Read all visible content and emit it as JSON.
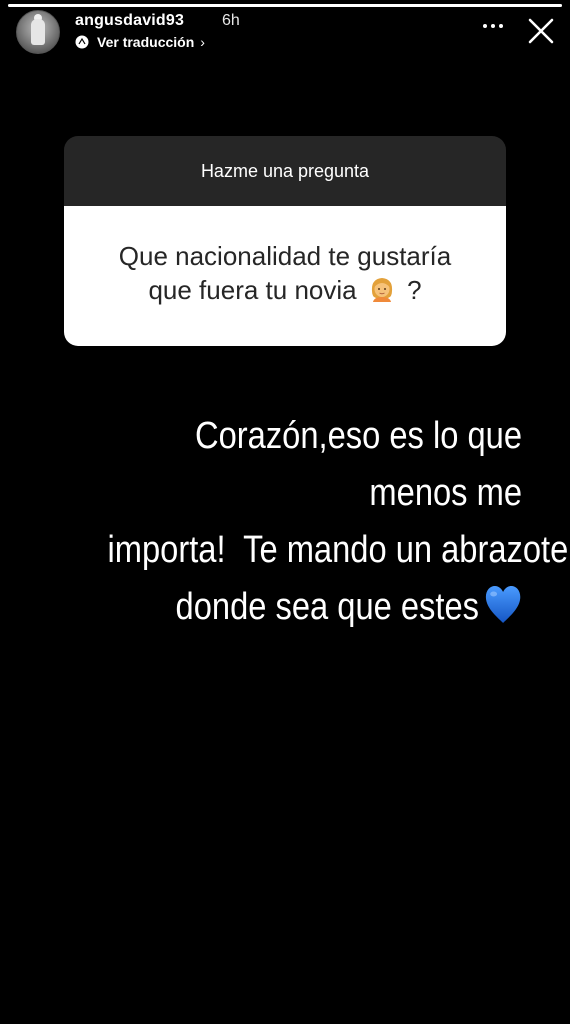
{
  "story": {
    "progress": 1.0,
    "username": "angusdavid93",
    "time": "6h",
    "translate_label": "Ver traducción",
    "translate_chevron": "›"
  },
  "question_sticker": {
    "prompt": "Hazme una pregunta",
    "question_line1": "Que nacionalidad te gustaría",
    "question_line2_before": "que fuera tu novia",
    "question_emoji": "woman-emoji",
    "question_line2_after": "?"
  },
  "answer": {
    "line1": "Corazón,eso es lo que menos me",
    "line2": "importa!  Te mando un abrazote",
    "line3": "donde sea que estes",
    "emoji": "blue-heart-icon"
  },
  "colors": {
    "background": "#000000",
    "sticker_header": "#262626",
    "sticker_body": "#ffffff",
    "heart": "#1f6fd6"
  }
}
